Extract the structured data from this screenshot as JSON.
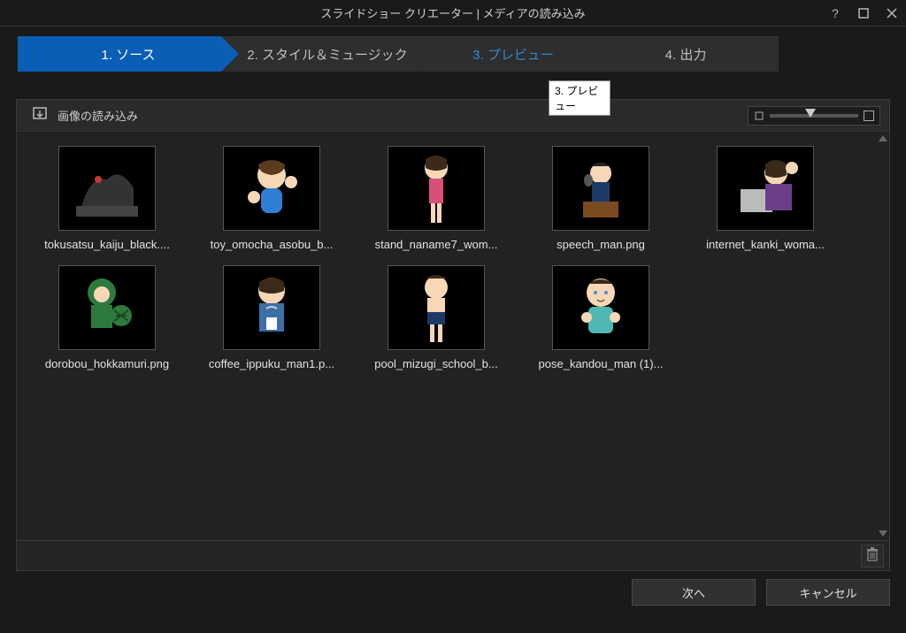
{
  "titlebar": {
    "title": "スライドショー クリエーター  |  メディアの読み込み"
  },
  "stepper": {
    "steps": [
      {
        "label": "1. ソース"
      },
      {
        "label": "2. スタイル＆ミュージック"
      },
      {
        "label": "3. プレビュー"
      },
      {
        "label": "4. 出力"
      }
    ],
    "tooltip": "3. プレビュー"
  },
  "toolbar": {
    "import_label": "画像の読み込み"
  },
  "thumbnails": [
    {
      "label": "tokusatsu_kaiju_black...."
    },
    {
      "label": "toy_omocha_asobu_b..."
    },
    {
      "label": "stand_naname7_wom..."
    },
    {
      "label": "speech_man.png"
    },
    {
      "label": "internet_kanki_woma..."
    },
    {
      "label": "dorobou_hokkamuri.png"
    },
    {
      "label": "coffee_ippuku_man1.p..."
    },
    {
      "label": "pool_mizugi_school_b..."
    },
    {
      "label": "pose_kandou_man (1)..."
    }
  ],
  "footer": {
    "next": "次へ",
    "cancel": "キャンセル"
  }
}
